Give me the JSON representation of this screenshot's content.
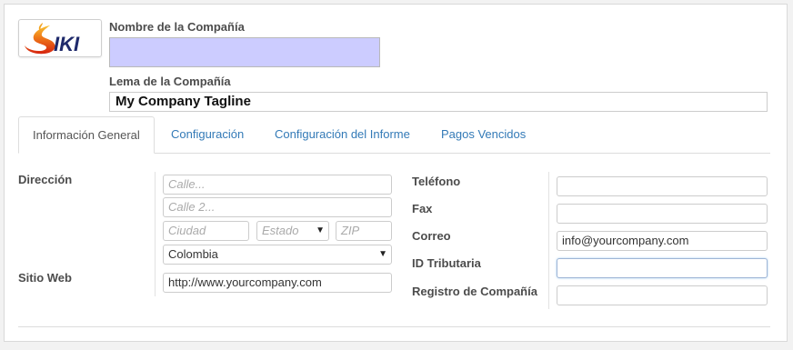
{
  "header": {
    "company_name_label": "Nombre de la Compañía",
    "company_name_value": "",
    "tagline_label": "Lema de la Compañía",
    "tagline_value": "My Company Tagline",
    "logo_text": "IKI"
  },
  "tabs": [
    {
      "label": "Información General",
      "active": true
    },
    {
      "label": "Configuración",
      "active": false
    },
    {
      "label": "Configuración del Informe",
      "active": false
    },
    {
      "label": "Pagos Vencidos",
      "active": false
    }
  ],
  "address": {
    "label": "Dirección",
    "street_placeholder": "Calle...",
    "street2_placeholder": "Calle 2...",
    "city_placeholder": "Ciudad",
    "state_placeholder": "Estado",
    "zip_placeholder": "ZIP",
    "country_value": "Colombia"
  },
  "website": {
    "label": "Sitio Web",
    "value": "http://www.yourcompany.com"
  },
  "contact": {
    "phone_label": "Teléfono",
    "phone_value": "",
    "fax_label": "Fax",
    "fax_value": "",
    "email_label": "Correo",
    "email_value": "info@yourcompany.com",
    "tax_id_label": "ID Tributaria",
    "tax_id_value": "",
    "company_registry_label": "Registro de Compañía",
    "company_registry_value": ""
  },
  "colors": {
    "required_field_bg": "#ccccff",
    "link": "#337ab7",
    "background": "#f2f2f2"
  }
}
